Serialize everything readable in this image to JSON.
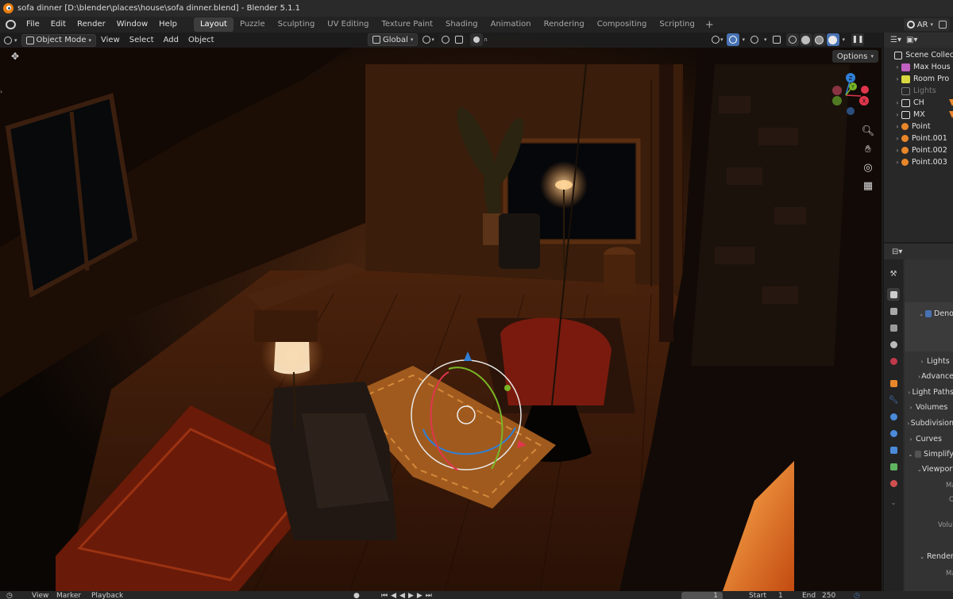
{
  "window": {
    "title": "sofa dinner [D:\\blender\\places\\house\\sofa dinner.blend] - Blender 5.1.1"
  },
  "menu": {
    "items": [
      "File",
      "Edit",
      "Render",
      "Window",
      "Help"
    ]
  },
  "workspaces": {
    "tabs": [
      "Layout",
      "Puzzle",
      "Sculpting",
      "UV Editing",
      "Texture Paint",
      "Shading",
      "Animation",
      "Rendering",
      "Compositing",
      "Scripting"
    ],
    "active": "Layout",
    "add_label": "+"
  },
  "scene_selector": {
    "value": "AR"
  },
  "viewport": {
    "mode": "Object Mode",
    "menus": [
      "View",
      "Select",
      "Add",
      "Object"
    ],
    "orientation": "Global",
    "options_label": "Options",
    "gizmo_axes": {
      "z": "Z",
      "y": "Y",
      "x": "X"
    },
    "colors": {
      "axis_x": "#e0364c",
      "axis_y": "#78b526",
      "axis_z": "#2f80d8",
      "active_toggle": "#4772b3"
    }
  },
  "outliner": {
    "rows": [
      {
        "label": "Scene Collec",
        "icon": "scene-collection-icon",
        "arrow": ""
      },
      {
        "label": "Max Hous",
        "icon": "collection-icon",
        "arrow": "›"
      },
      {
        "label": "Room Pro",
        "icon": "collection-icon",
        "arrow": "›"
      },
      {
        "label": "Lights",
        "icon": "collection-icon",
        "arrow": ""
      },
      {
        "label": "CH",
        "icon": "collection-icon",
        "arrow": "›"
      },
      {
        "label": "MX",
        "icon": "collection-icon",
        "arrow": "›"
      },
      {
        "label": "Point",
        "icon": "point-light-icon",
        "arrow": "›"
      },
      {
        "label": "Point.001",
        "icon": "point-light-icon",
        "arrow": "›"
      },
      {
        "label": "Point.002",
        "icon": "point-light-icon",
        "arrow": "›"
      },
      {
        "label": "Point.003",
        "icon": "point-light-icon",
        "arrow": "›"
      }
    ]
  },
  "properties": {
    "panels": [
      {
        "label": "Deno",
        "arrow": "⌄",
        "checkbox": true
      },
      {
        "label": "Lights",
        "arrow": "›"
      },
      {
        "label": "Advance",
        "arrow": "›"
      },
      {
        "label": "Light Paths",
        "arrow": "›"
      },
      {
        "label": "Volumes",
        "arrow": "›"
      },
      {
        "label": "Subdivision",
        "arrow": "›"
      },
      {
        "label": "Curves",
        "arrow": "›"
      },
      {
        "label": "Simplify",
        "arrow": "⌄",
        "checkbox": false
      },
      {
        "label": "Viewport",
        "arrow": "⌄"
      },
      {
        "label": "Render",
        "arrow": "⌄"
      }
    ],
    "sublabels": [
      "Ma",
      "C",
      "Volu",
      "Ma"
    ]
  },
  "timeline": {
    "menus": [
      "View",
      "Marker",
      "Playback"
    ],
    "current_frame": "1",
    "start_label": "Start",
    "start_value": "1",
    "end_label": "End",
    "end_value": "250"
  }
}
